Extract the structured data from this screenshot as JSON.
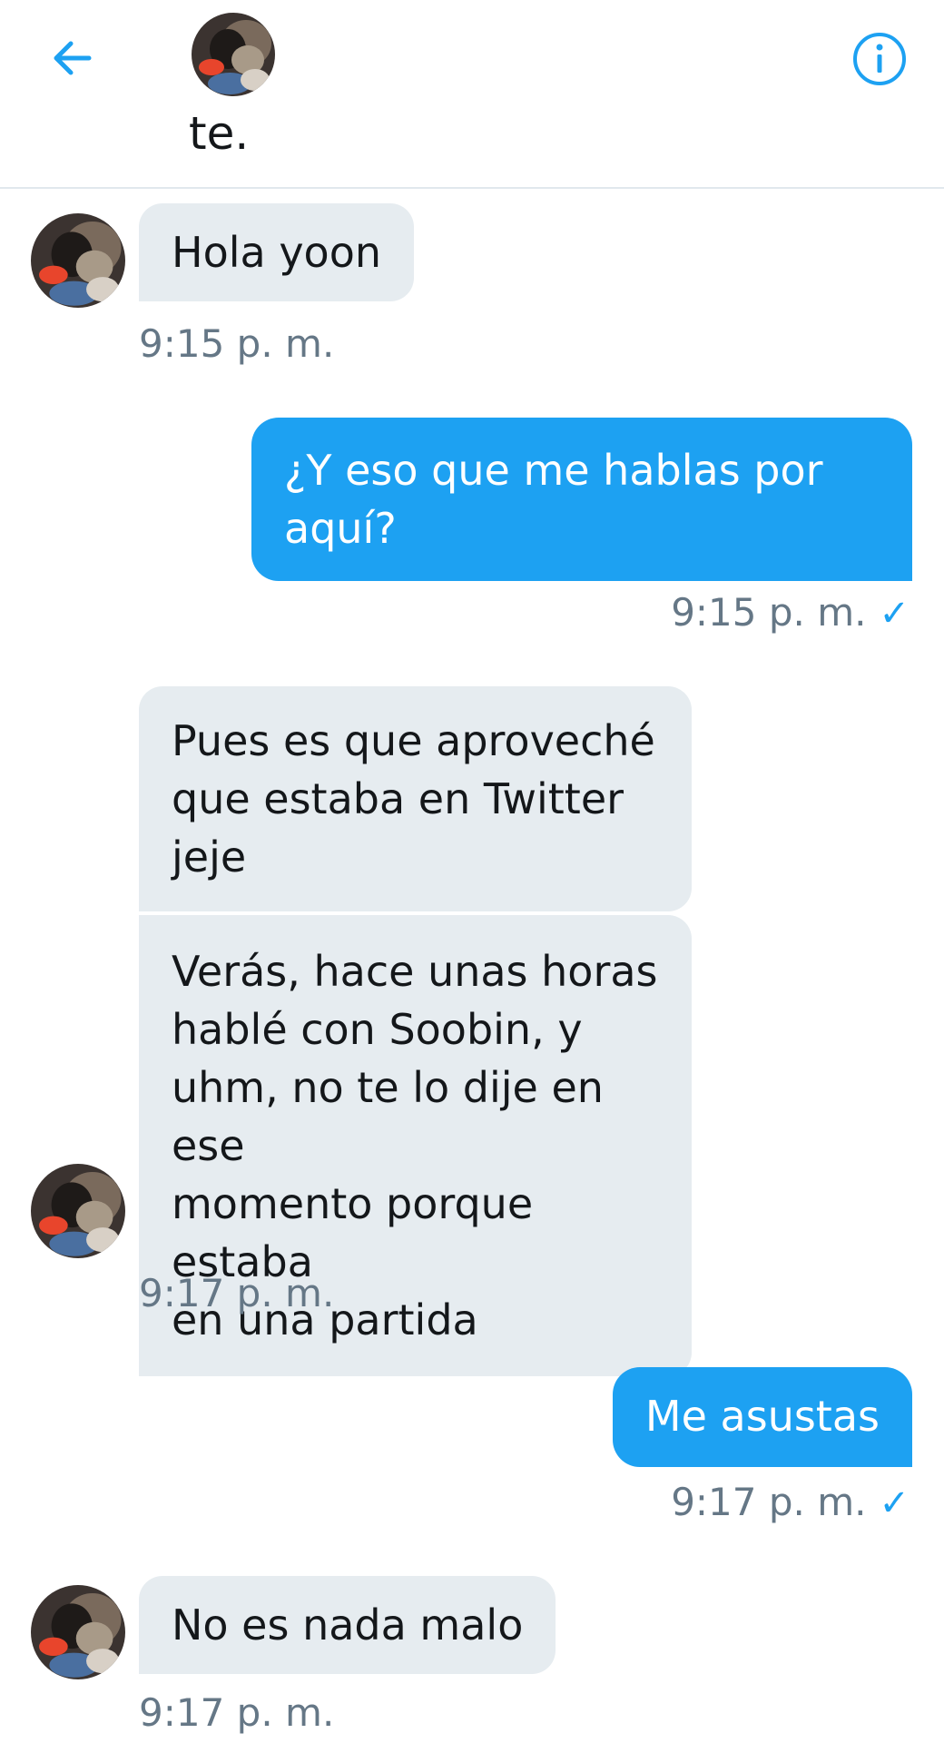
{
  "header": {
    "name": "te."
  },
  "colors": {
    "accent": "#1da1f2",
    "incoming_bubble": "#e6ecf0",
    "timestamp": "#657786"
  },
  "messages": [
    {
      "text": "Hola yoon",
      "time": "9:15 p. m."
    },
    {
      "text": "¿Y eso que me hablas por\naquí?",
      "time": "9:15 p. m."
    },
    {
      "text": "Pues es que aproveché\nque estaba en Twitter\njeje"
    },
    {
      "text": "Verás, hace unas horas\nhablé con Soobin, y\nuhm, no te lo dije en ese\nmomento porque estaba\nen una partida",
      "time": "9:17 p. m."
    },
    {
      "text": "Me asustas",
      "time": "9:17 p. m."
    },
    {
      "text": "No es nada malo",
      "time": "9:17 p. m."
    }
  ],
  "icons": {
    "back": "arrow-left-icon",
    "info": "info-icon",
    "read_receipt": "checkmark-icon"
  }
}
